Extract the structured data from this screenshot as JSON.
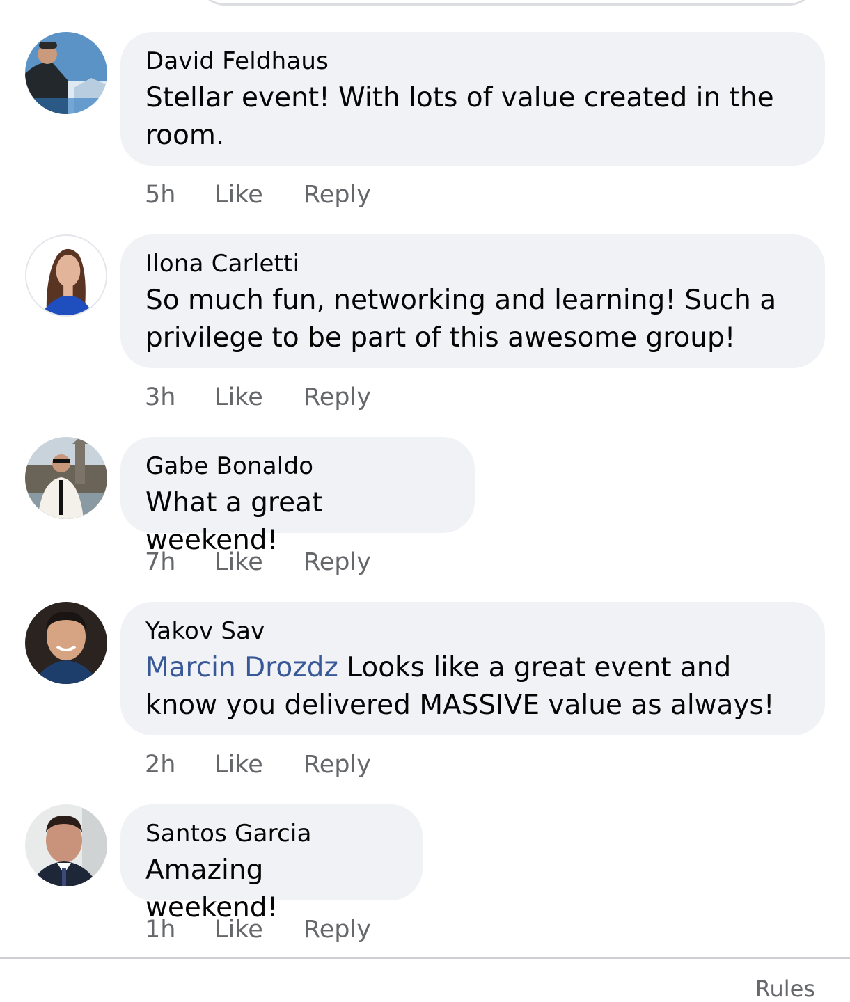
{
  "comments": [
    {
      "author": "David Feldhaus",
      "text": "Stellar event! With lots of value created in the room.",
      "time": "5h",
      "like_label": "Like",
      "reply_label": "Reply",
      "avatar_icon": "profile-photo-outdoor"
    },
    {
      "author": "Ilona Carletti",
      "text": "So much fun, networking and learning! Such a privilege to be part of this awesome group!",
      "time": "3h",
      "like_label": "Like",
      "reply_label": "Reply",
      "avatar_icon": "profile-photo-portrait"
    },
    {
      "author": "Gabe Bonaldo",
      "text": "What a great weekend!",
      "time": "7h",
      "like_label": "Like",
      "reply_label": "Reply",
      "avatar_icon": "profile-photo-building"
    },
    {
      "author": "Yakov Sav",
      "mention": "Marcin Drozdz",
      "text": " Looks like a great event and know you delivered MASSIVE value as always!",
      "time": "2h",
      "like_label": "Like",
      "reply_label": "Reply",
      "avatar_icon": "profile-photo-portrait"
    },
    {
      "author": "Santos Garcia",
      "text": "Amazing weekend!",
      "time": "1h",
      "like_label": "Like",
      "reply_label": "Reply",
      "avatar_icon": "profile-photo-portrait"
    }
  ],
  "footer": {
    "rules_label": "Rules"
  },
  "colors": {
    "bubble": "#f0f2f5",
    "mention": "#385898",
    "secondary_text": "#65676b"
  }
}
